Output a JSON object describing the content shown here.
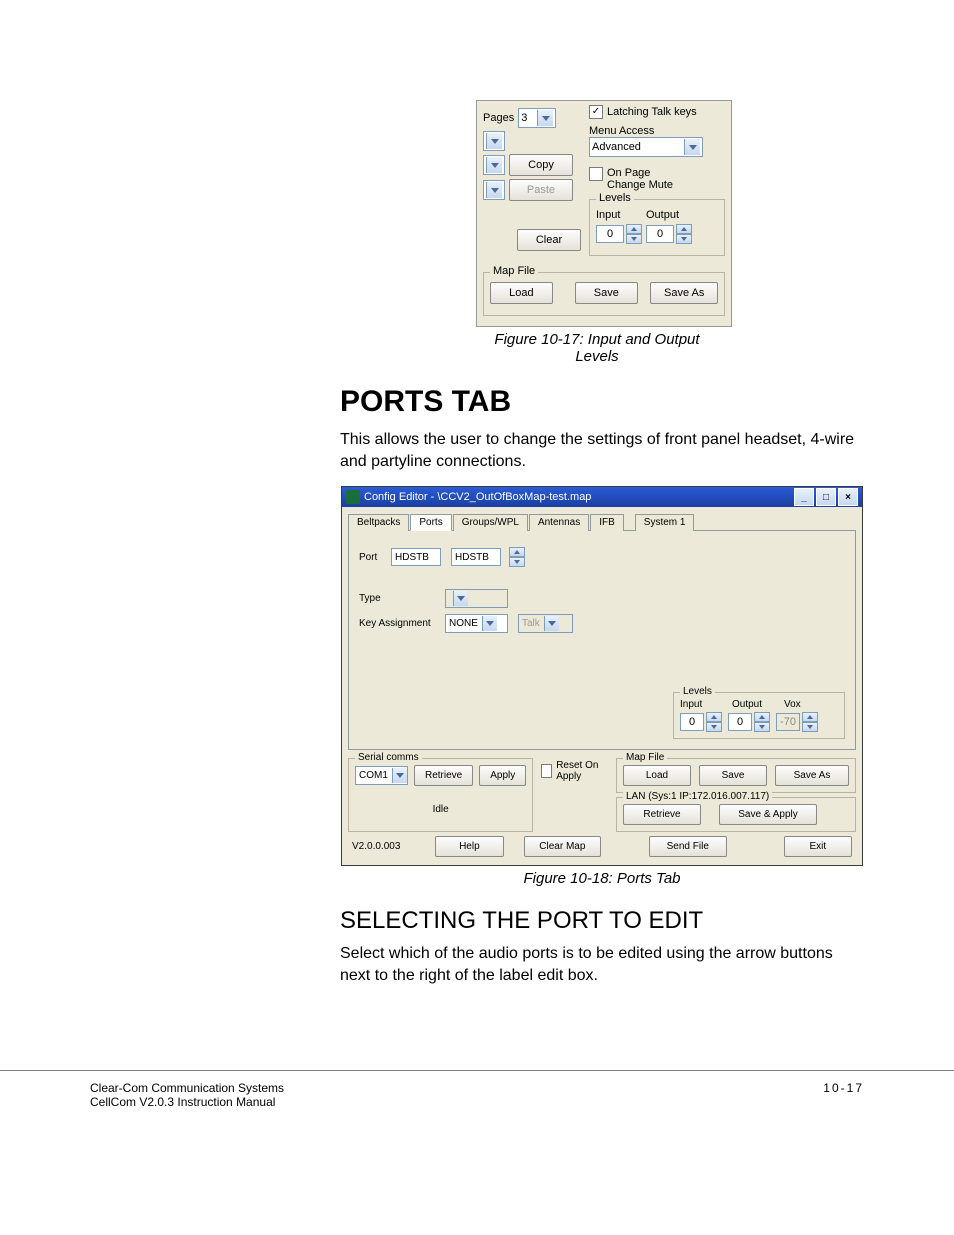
{
  "fig1": {
    "latching_label": "Latching Talk keys",
    "latching_checked": true,
    "pages_label": "Pages",
    "pages_value": "3",
    "copy": "Copy",
    "paste": "Paste",
    "clear": "Clear",
    "menu_access_label": "Menu Access",
    "menu_access_value": "Advanced",
    "onpage_label": "On Page Change Mute",
    "levels_title": "Levels",
    "input_label": "Input",
    "output_label": "Output",
    "input_val": "0",
    "output_val": "0",
    "mapfile_title": "Map File",
    "load": "Load",
    "save": "Save",
    "saveas": "Save As",
    "caption": "Figure 10-17: Input and Output Levels"
  },
  "text": {
    "h1": "PORTS TAB",
    "p1": "This allows the user to change the settings of front panel headset, 4-wire and partyline connections.",
    "h2": "SELECTING THE PORT TO EDIT",
    "p2": "Select which of the audio ports is to be edited using the arrow buttons next to the right of the label edit box."
  },
  "fig2": {
    "title": "Config Editor - \\CCV2_OutOfBoxMap-test.map",
    "tabs": [
      "Beltpacks",
      "Ports",
      "Groups/WPL",
      "Antennas",
      "IFB",
      "System 1"
    ],
    "active_tab": 1,
    "port_label": "Port",
    "port_val1": "HDSTB",
    "port_val2": "HDSTB",
    "type_label": "Type",
    "key_label": "Key Assignment",
    "key_val": "NONE",
    "talk_val": "Talk",
    "levels_title": "Levels",
    "input_label": "Input",
    "output_label": "Output",
    "vox_label": "Vox",
    "input_val": "0",
    "output_val": "0",
    "vox_val": "-70",
    "serial_title": "Serial comms",
    "serial_port": "COM1",
    "retrieve": "Retrieve",
    "apply": "Apply",
    "idle": "Idle",
    "reset_label": "Reset On Apply",
    "mapfile_title": "Map File",
    "load": "Load",
    "save": "Save",
    "saveas": "Save As",
    "lan_title": "LAN  (Sys:1 IP:172.016.007.117)",
    "retrieve2": "Retrieve",
    "saveapply": "Save & Apply",
    "version": "V2.0.0.003",
    "help": "Help",
    "clearmap": "Clear Map",
    "sendfile": "Send File",
    "exit": "Exit",
    "caption": "Figure 10-18: Ports Tab"
  },
  "footer": {
    "left1": "Clear-Com Communication Systems",
    "left2": "CellCom V2.0.3 Instruction Manual",
    "right": "10-17"
  }
}
